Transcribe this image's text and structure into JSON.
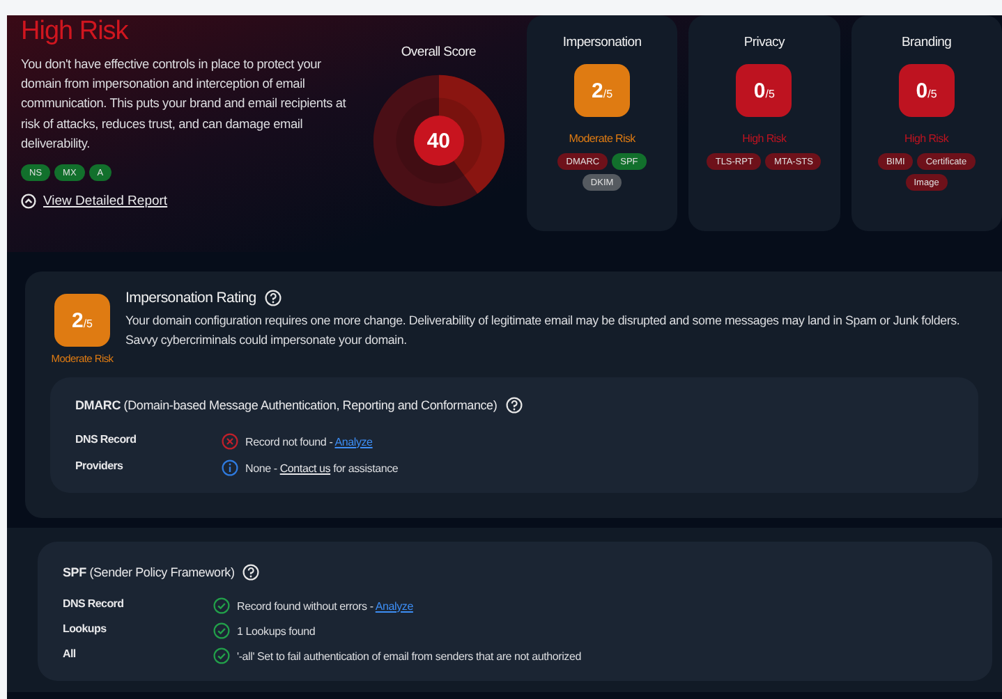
{
  "summary": {
    "title": "High Risk",
    "description": "You don't have effective controls in place to protect your domain from impersonation and interception of email communication. This puts your brand and email recipients at risk of attacks, reduces trust, and can damage email deliverability.",
    "tags": [
      {
        "label": "NS",
        "color": "#12702c"
      },
      {
        "label": "MX",
        "color": "#12702c"
      },
      {
        "label": "A",
        "color": "#12702c"
      }
    ],
    "report_link": "View Detailed Report"
  },
  "overall": {
    "title": "Overall Score",
    "score": "40"
  },
  "categories": [
    {
      "title": "Impersonation",
      "score": "2",
      "out_of": "/5",
      "color": "#df7b12",
      "risk_label": "Moderate Risk",
      "tags": [
        {
          "label": "DMARC",
          "color": "#6e111a"
        },
        {
          "label": "SPF",
          "color": "#12702c"
        },
        {
          "label": "DKIM",
          "color": "#555a60"
        }
      ]
    },
    {
      "title": "Privacy",
      "score": "0",
      "out_of": "/5",
      "color": "#be1320",
      "risk_label": "High Risk",
      "tags": [
        {
          "label": "TLS-RPT",
          "color": "#6e111a"
        },
        {
          "label": "MTA-STS",
          "color": "#6e111a"
        }
      ]
    },
    {
      "title": "Branding",
      "score": "0",
      "out_of": "/5",
      "color": "#be1320",
      "risk_label": "High Risk",
      "tags": [
        {
          "label": "BIMI",
          "color": "#6e111a"
        },
        {
          "label": "Certificate",
          "color": "#6e111a"
        },
        {
          "label": "Image",
          "color": "#6e111a"
        }
      ]
    }
  ],
  "rating": {
    "score": "2",
    "out_of": "/5",
    "color": "#df7b12",
    "risk_label": "Moderate Risk",
    "title": "Impersonation Rating",
    "description": "Your domain configuration requires one more change. Deliverability of legitimate email may be disrupted and some messages may land in Spam or Junk folders. Savvy cybercriminals could impersonate your domain."
  },
  "checks": [
    {
      "name": "DMARC",
      "full_name": "(Domain-based Message Authentication, Reporting and Conformance)",
      "rows": [
        {
          "label": "DNS Record",
          "kind": "error",
          "text": "Record not found - ",
          "link": {
            "label": "Analyze",
            "color": "#3d8ef5"
          }
        },
        {
          "label": "Providers",
          "kind": "info",
          "text": "None - ",
          "link": {
            "label": "Contact us",
            "color": "#e8e8ea"
          },
          "after": " for assistance"
        }
      ]
    },
    {
      "name": "SPF",
      "full_name": "(Sender Policy Framework)",
      "rows": [
        {
          "label": "DNS Record",
          "kind": "ok",
          "text": "Record found without errors - ",
          "link": {
            "label": "Analyze",
            "color": "#3d8ef5"
          }
        },
        {
          "label": "Lookups",
          "kind": "ok",
          "text": "1 Lookups found"
        },
        {
          "label": "All",
          "kind": "ok",
          "text": "'-all' Set to fail authentication of email from senders that are not authorized"
        }
      ]
    }
  ]
}
